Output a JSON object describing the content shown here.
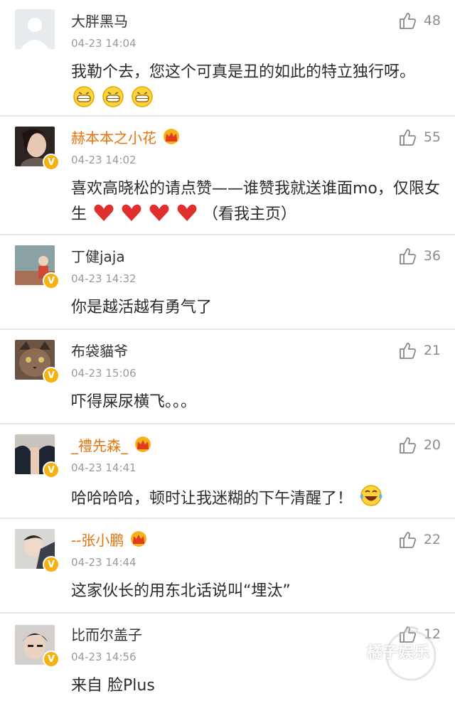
{
  "comments": [
    {
      "name": "大胖黑马",
      "time": "04-23 14:04",
      "text": "我勒个去，您这个可真是丑的如此的特立独行呀。",
      "likes": "48",
      "vip": false,
      "verified": false,
      "emoji": [
        "grin",
        "grin",
        "grin"
      ]
    },
    {
      "name": "赫本本之小花",
      "time": "04-23 14:02",
      "text": "喜欢高晓松的请点赞——谁赞我就送谁面mo，仅限女生",
      "text_after": "（看我主页）",
      "likes": "55",
      "vip": true,
      "verified": true,
      "emoji": [
        "heart",
        "heart",
        "heart",
        "heart"
      ]
    },
    {
      "name": "丁健jaja",
      "time": "04-23 14:32",
      "text": "你是越活越有勇气了",
      "likes": "36",
      "vip": false,
      "verified": true
    },
    {
      "name": "布袋貓爷",
      "time": "04-23 15:06",
      "text": "吓得屎尿横飞。。。",
      "likes": "21",
      "vip": false,
      "verified": true
    },
    {
      "name": "_禮先森_",
      "time": "04-23 14:41",
      "text": "哈哈哈哈，顿时让我迷糊的下午清醒了！",
      "likes": "20",
      "vip": true,
      "verified": true,
      "emoji": [
        "laugh"
      ]
    },
    {
      "name": "--张小鹏",
      "time": "04-23 14:44",
      "text": "这家伙长的用东北话说叫“埋汰”",
      "likes": "22",
      "vip": true,
      "verified": true
    },
    {
      "name": "比而尔盖子",
      "time": "04-23 14:56",
      "text": "来自 脸Plus",
      "likes": "12",
      "vip": false,
      "verified": true
    }
  ],
  "watermark": {
    "text": "橘子娱乐"
  },
  "colors": {
    "vip_name": "#e8720c",
    "badge": "#f6b10e",
    "heart": "#e0302e"
  },
  "icons": {
    "like": "thumbs-up-icon",
    "crown": "crown-vip-icon",
    "verified": "verified-v-icon"
  }
}
